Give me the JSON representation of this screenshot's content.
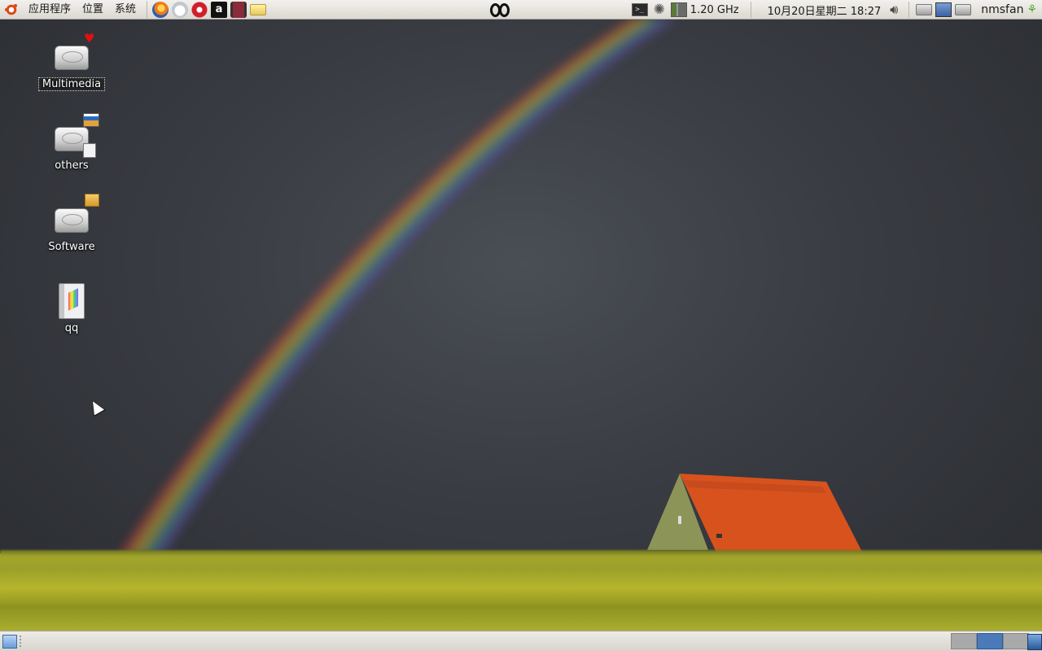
{
  "top_panel": {
    "menus": [
      "应用程序",
      "位置",
      "系统"
    ],
    "launchers": [
      {
        "icon": "firefox-icon"
      },
      {
        "icon": "mail-icon"
      },
      {
        "icon": "opera-icon"
      },
      {
        "icon": "anki-icon",
        "glyph": "a"
      },
      {
        "icon": "film-icon"
      },
      {
        "icon": "notes-icon"
      }
    ],
    "cpu_freq": "1.20 GHz",
    "clock": "10月20日星期二 18:27",
    "user": "nmsfan"
  },
  "desktop": {
    "icons": [
      {
        "label": "Multimedia",
        "icon": "drive-icon",
        "emblem": "heart-emblem-icon",
        "selected": true
      },
      {
        "label": "others",
        "icon": "drive-icon",
        "emblem": "photo-doc-emblem-icon"
      },
      {
        "label": "Software",
        "icon": "drive-icon",
        "emblem": "package-emblem-icon"
      },
      {
        "label": "qq",
        "icon": "book-icon"
      }
    ]
  },
  "bottom_panel": {
    "workspaces": [
      {
        "active": false
      },
      {
        "active": true
      },
      {
        "active": false
      }
    ]
  },
  "colors": {
    "panel": "#dcd8d1",
    "sky": "#393c42",
    "field": "#a7a62e",
    "roof": "#d8521e"
  }
}
